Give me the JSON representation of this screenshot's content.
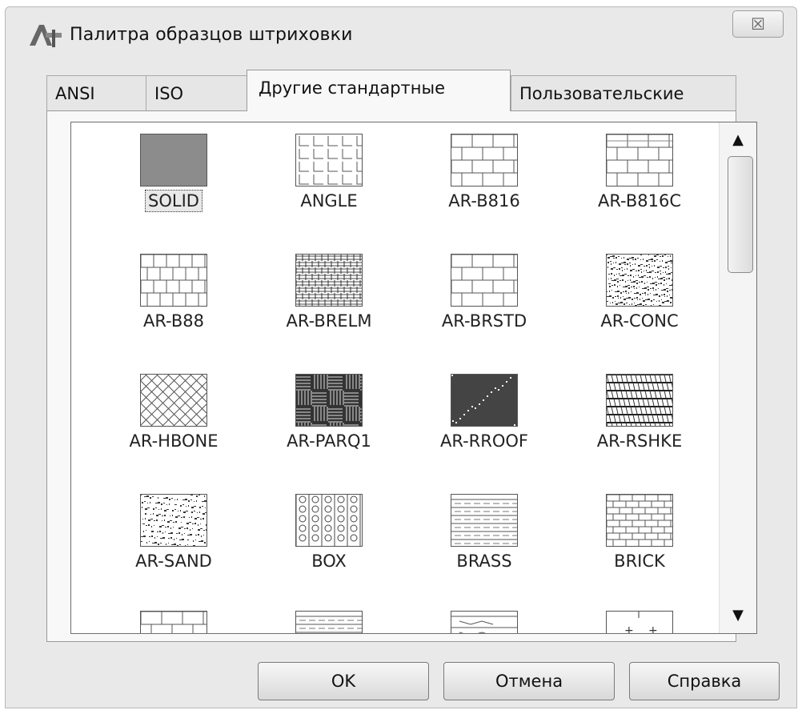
{
  "window": {
    "title": "Палитра образцов штриховки",
    "close_glyph": "☒",
    "app_icon": "autocad-icon"
  },
  "tabs": [
    {
      "label": "ANSI",
      "active": false
    },
    {
      "label": "ISO",
      "active": false
    },
    {
      "label": "Другие стандартные",
      "active": true
    },
    {
      "label": "Пользовательские",
      "active": false
    }
  ],
  "patterns": [
    {
      "name": "SOLID",
      "selected": true
    },
    {
      "name": "ANGLE",
      "selected": false
    },
    {
      "name": "AR-B816",
      "selected": false
    },
    {
      "name": "AR-B816C",
      "selected": false
    },
    {
      "name": "AR-B88",
      "selected": false
    },
    {
      "name": "AR-BRELM",
      "selected": false
    },
    {
      "name": "AR-BRSTD",
      "selected": false
    },
    {
      "name": "AR-CONC",
      "selected": false
    },
    {
      "name": "AR-HBONE",
      "selected": false
    },
    {
      "name": "AR-PARQ1",
      "selected": false
    },
    {
      "name": "AR-RROOF",
      "selected": false
    },
    {
      "name": "AR-RSHKE",
      "selected": false
    },
    {
      "name": "AR-SAND",
      "selected": false
    },
    {
      "name": "BOX",
      "selected": false
    },
    {
      "name": "BRASS",
      "selected": false
    },
    {
      "name": "BRICK",
      "selected": false
    },
    {
      "name": "",
      "selected": false
    },
    {
      "name": "",
      "selected": false
    },
    {
      "name": "",
      "selected": false
    },
    {
      "name": "",
      "selected": false
    }
  ],
  "scrollbar": {
    "up_glyph": "▲",
    "down_glyph": "▼"
  },
  "buttons": {
    "ok": "OK",
    "cancel": "Отмена",
    "help": "Справка"
  },
  "colors": {
    "dialog_bg": "#e9e9e9",
    "solid_fill": "#8c8c8c",
    "dark_fill": "#444444"
  }
}
